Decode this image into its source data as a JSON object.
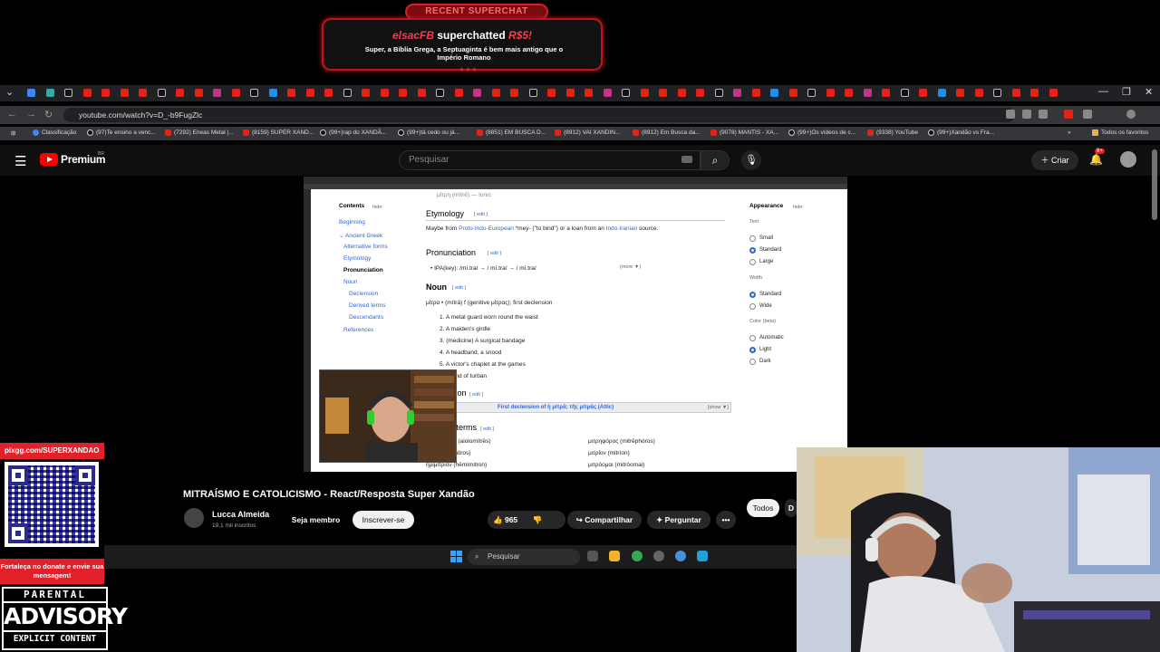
{
  "superchat": {
    "header": "RECENT SUPERCHAT",
    "user": "elsacFB",
    "action": "superchatted",
    "amount": "R$5!",
    "message": "Super, a Bíblia Grega, a Septuaginta é bem mais antigo que o Império Romano"
  },
  "browser": {
    "url": "youtube.com/watch?v=D_-b9FugZlc",
    "bookmarks": [
      "Classificação",
      "(97)Te ensino a venc...",
      "(7292) Eneas Metal |...",
      "(8159) SUPER XAND...",
      "(99+)rap do XANDÃ...",
      "(99+)tá cedo ou já...",
      "(8851) EM BUSCA D...",
      "(8912) VAI XANDIN...",
      "(8912) Em Busca da...",
      "(9078) MANTIS - XA...",
      "(99+)Os vídeos de c...",
      "(9338) YouTube",
      "(99+)Xandão vs Fra..."
    ],
    "all_favorites": "Todos os favoritos"
  },
  "youtube": {
    "brand": "Premium",
    "region": "BR",
    "search_placeholder": "Pesquisar",
    "create_label": "Criar",
    "notif_count": "9+"
  },
  "wiktionary": {
    "contents_label": "Contents",
    "hide": "hide",
    "toc": [
      "Beginning",
      "Ancient Greek",
      "Alternative forms",
      "Etymology",
      "Pronunciation",
      "Noun",
      "Declension",
      "Derived terms",
      "Descendants",
      "References"
    ],
    "top_line": "μίτρη (mítrē) — Ionic",
    "etymology_h": "Etymology",
    "edit": "edit",
    "etymology_text_1": "Maybe from ",
    "etymology_link": "Proto-Indo-European",
    "etymology_text_2": " *mey- (\"to bind\") or a loan from an ",
    "etymology_link2": "Indo-Iranian",
    "etymology_text_3": " source.",
    "pron_h": "Pronunciation",
    "ipa": "IPA(key): /mí.tra/ → / mí.tra/ → / mí.tra/",
    "more": "(more ▼)",
    "noun_h": "Noun",
    "headword": "μίτρα • (mítrā) f (genitive μίτρας); first declension",
    "senses": [
      "1. A metal guard worn round the waist",
      "2. A maiden's girdle",
      "3. (medicine) A surgical bandage",
      "4. A headband, a snood",
      "5. A victor's chaplet at the games",
      "6. A kind of turban"
    ],
    "declension_h": "Declension",
    "declension_bar": "First declension of ἡ μίτρᾱ; τῆς μίτρᾱς (Attic)",
    "show": "[show ▼]",
    "derived_h": "Derived terms",
    "derived_left": [
      "αἰολομίτρης (aiolomítrēs)",
      "ἄμιτρος (ámitros)",
      "ἡμιμίτριον (hēmímitron)"
    ],
    "derived_right": [
      "μιτρηφόρος (mitrēphóros)",
      "μιτρίον (mitríon)",
      "μιτρόομαι (mitróomai)"
    ],
    "appearance_h": "Appearance",
    "text_h": "Text",
    "text_opts": [
      "Small",
      "Standard",
      "Large"
    ],
    "width_h": "Width",
    "width_opts": [
      "Standard",
      "Wide"
    ],
    "color_h": "Color (beta)",
    "color_opts": [
      "Automatic",
      "Light",
      "Dark"
    ]
  },
  "video": {
    "title": "MITRAÍSMO E CATOLICISMO - React/Resposta Super Xandão",
    "channel": "Lucca Almeida",
    "subscribers": "19,1 mil inscritos",
    "join": "Seja membro",
    "subscribe": "Inscrever-se",
    "likes": "965",
    "share": "Compartilhar",
    "ask": "Perguntar",
    "chip_all": "Todos",
    "chip_next": "D"
  },
  "taskbar": {
    "search": "Pesquisar"
  },
  "donate": {
    "handle": "pixgg.com/SUPERXANDAO",
    "text": "Fortaleça no donate e envie sua mensagem!"
  },
  "advisory": {
    "line1": "PARENTAL",
    "line2": "ADVISORY",
    "line3": "EXPLICIT CONTENT"
  },
  "colors": {
    "youtube_red": "#FF0000",
    "superchat_red": "#C0121B",
    "link_blue": "#3366CC"
  }
}
